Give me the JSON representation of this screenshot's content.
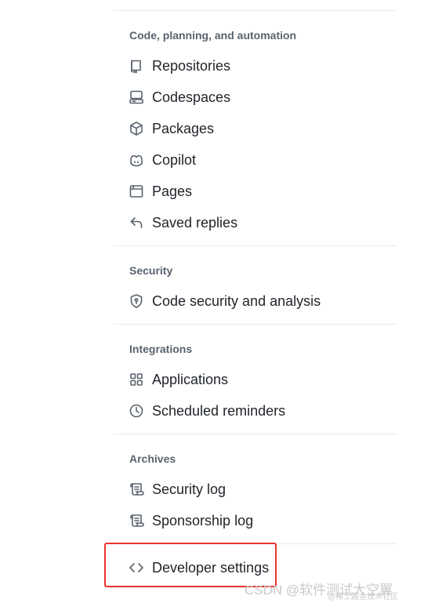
{
  "sections": [
    {
      "title": "Code, planning, and automation",
      "items": [
        {
          "label": "Repositories",
          "icon": "repo-icon"
        },
        {
          "label": "Codespaces",
          "icon": "codespaces-icon"
        },
        {
          "label": "Packages",
          "icon": "package-icon"
        },
        {
          "label": "Copilot",
          "icon": "copilot-icon"
        },
        {
          "label": "Pages",
          "icon": "browser-icon"
        },
        {
          "label": "Saved replies",
          "icon": "reply-icon"
        }
      ]
    },
    {
      "title": "Security",
      "items": [
        {
          "label": "Code security and analysis",
          "icon": "shield-lock-icon"
        }
      ]
    },
    {
      "title": "Integrations",
      "items": [
        {
          "label": "Applications",
          "icon": "apps-icon"
        },
        {
          "label": "Scheduled reminders",
          "icon": "clock-icon"
        }
      ]
    },
    {
      "title": "Archives",
      "items": [
        {
          "label": "Security log",
          "icon": "log-icon"
        },
        {
          "label": "Sponsorship log",
          "icon": "log-icon"
        }
      ]
    }
  ],
  "developer": {
    "label": "Developer settings",
    "icon": "code-icon"
  },
  "highlight_color": "#e8322d",
  "watermark": {
    "main": "CSDN @软件测试大空翼",
    "small": "@稀土掘金技术社区"
  }
}
